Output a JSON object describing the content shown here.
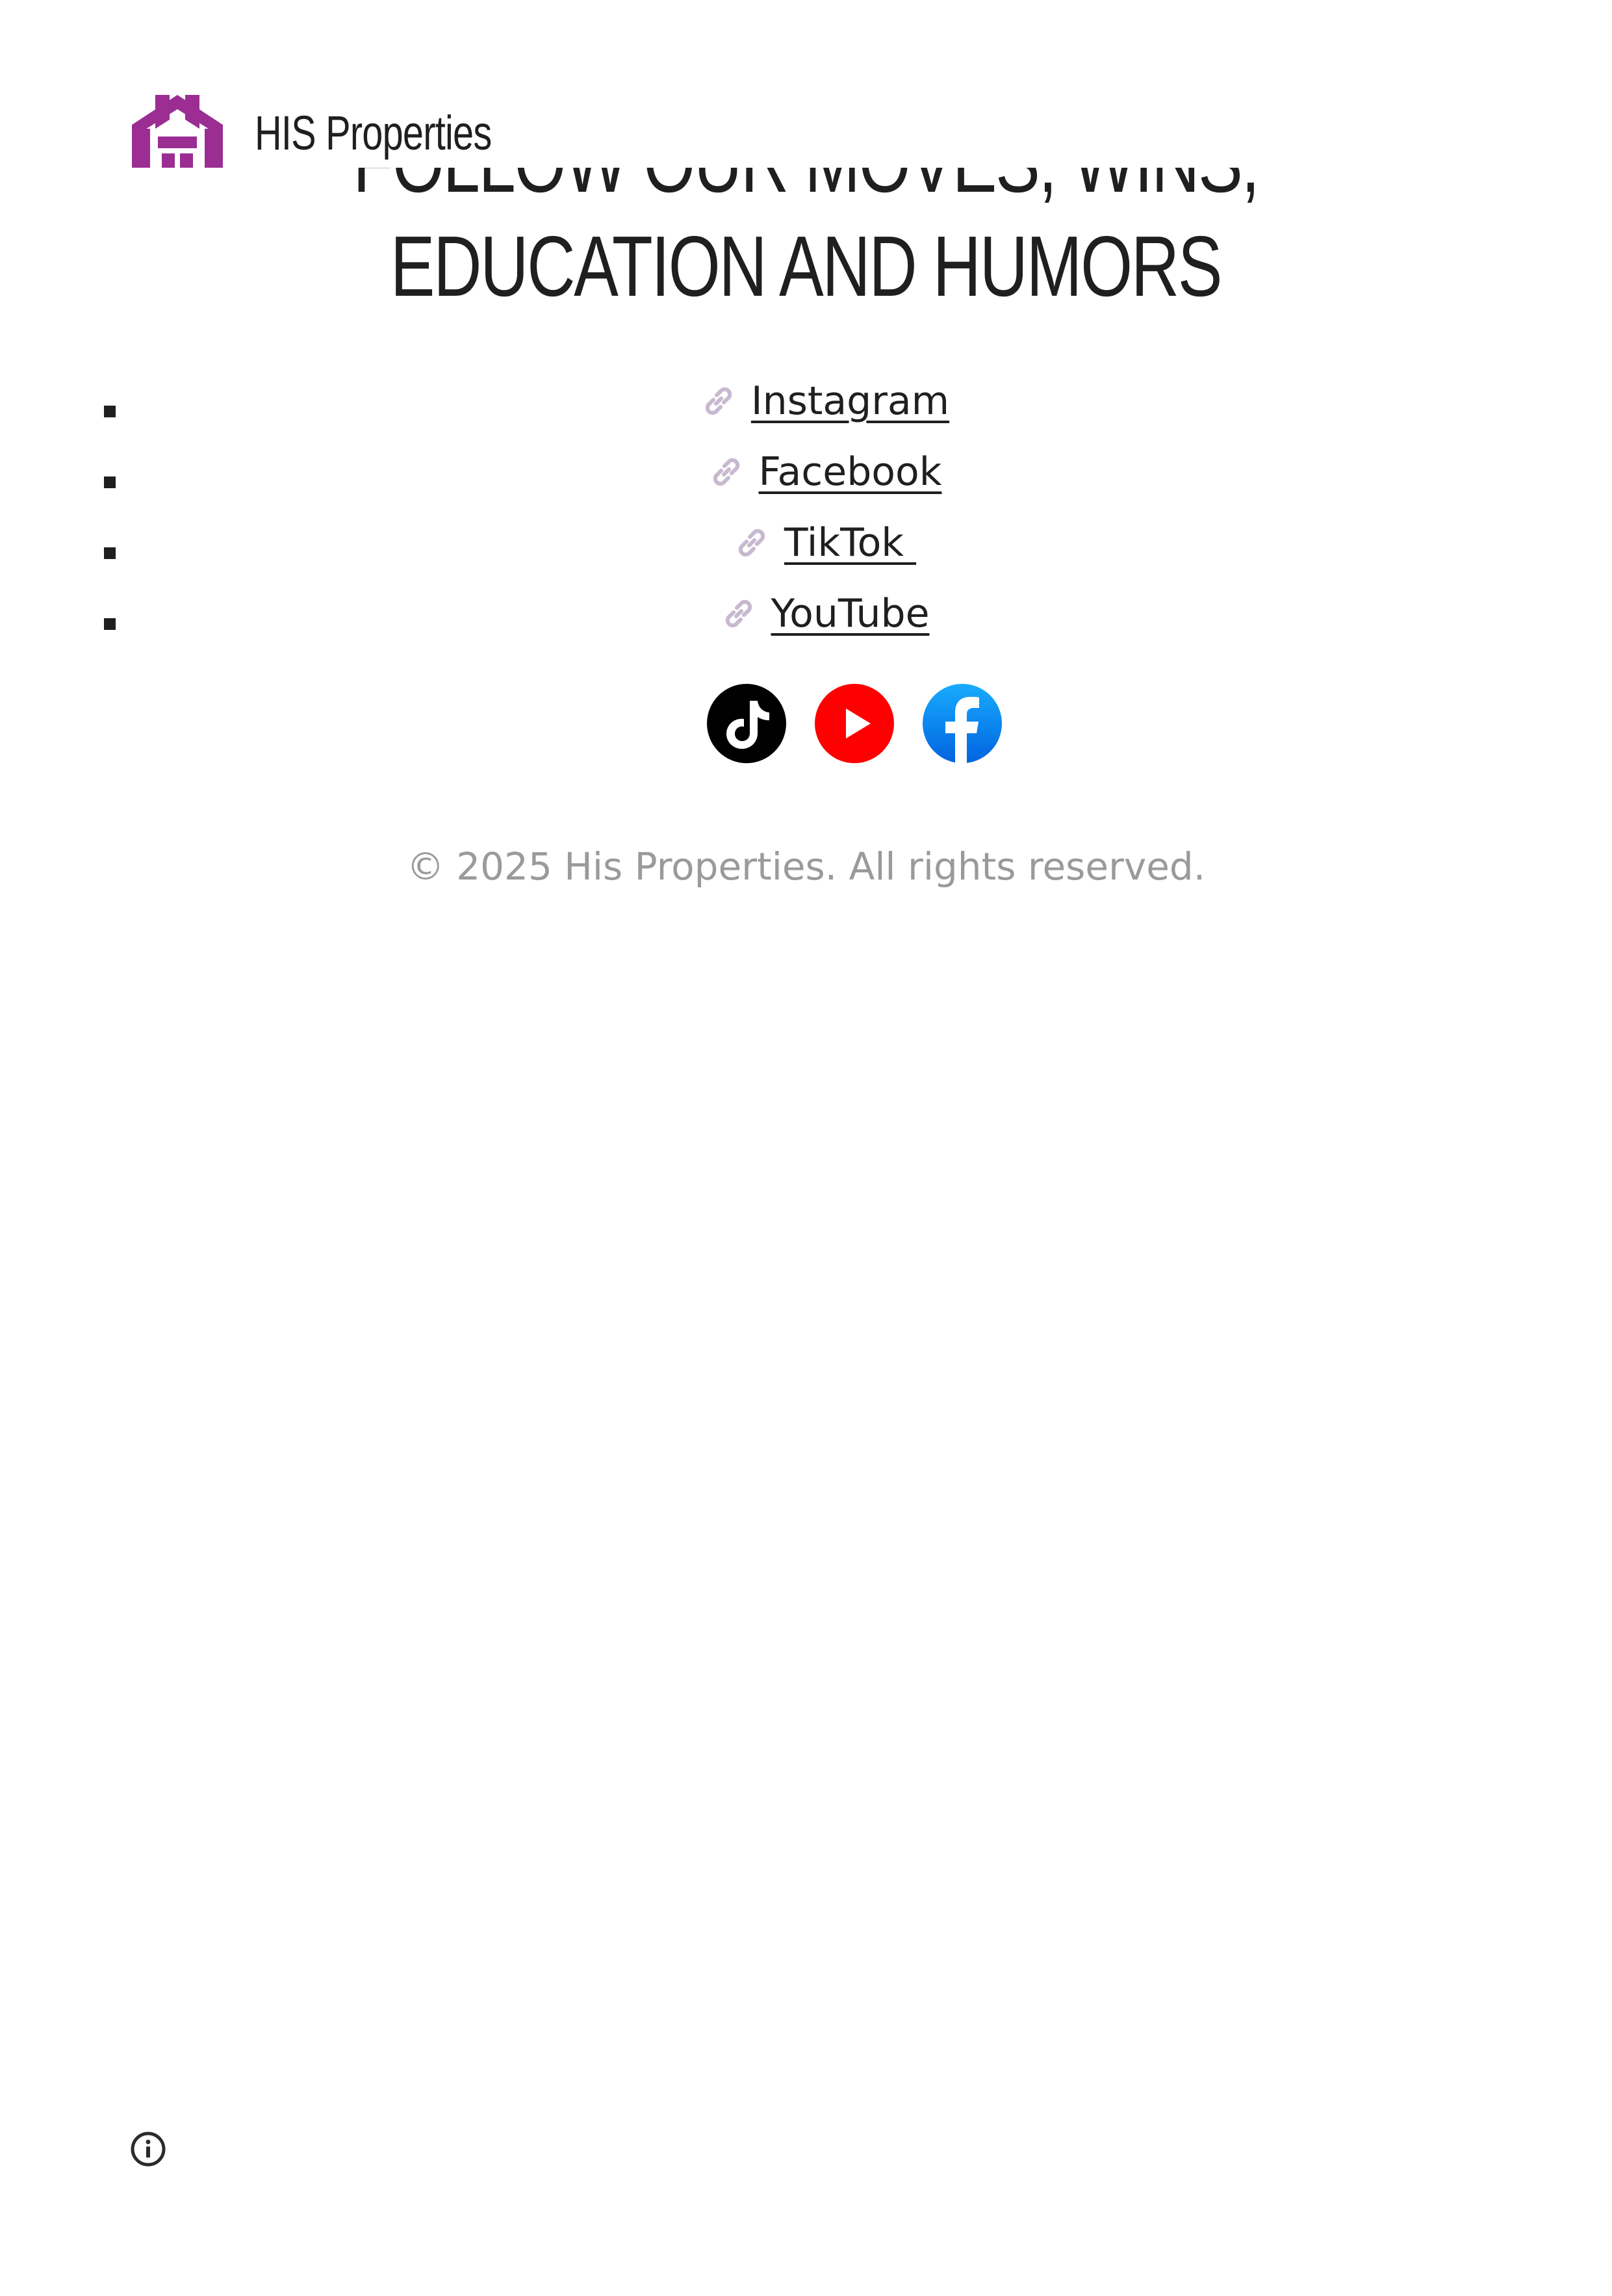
{
  "header": {
    "brand_name": "HIS Properties",
    "logo_icon": "house-logo-icon",
    "logo_color": "#9b2d93"
  },
  "section": {
    "heading": "FOLLOW OUR MOVES, WINS, EDUCATION AND HUMORS"
  },
  "links": [
    {
      "label": "Instagram",
      "icon": "link-chain-icon"
    },
    {
      "label": "Facebook",
      "icon": "link-chain-icon"
    },
    {
      "label": "TikTok ",
      "icon": "link-chain-icon"
    },
    {
      "label": "YouTube",
      "icon": "link-chain-icon"
    }
  ],
  "social_icons": [
    {
      "name": "tiktok-icon",
      "color": "#000000"
    },
    {
      "name": "youtube-icon",
      "color": "#ff0000"
    },
    {
      "name": "facebook-icon",
      "color": "#1877f2"
    }
  ],
  "footer": {
    "copyright": "© 2025 His Properties. All rights reserved."
  },
  "colors": {
    "link_icon": "#c7b9cf",
    "copyright_text": "#9a9a9a"
  }
}
